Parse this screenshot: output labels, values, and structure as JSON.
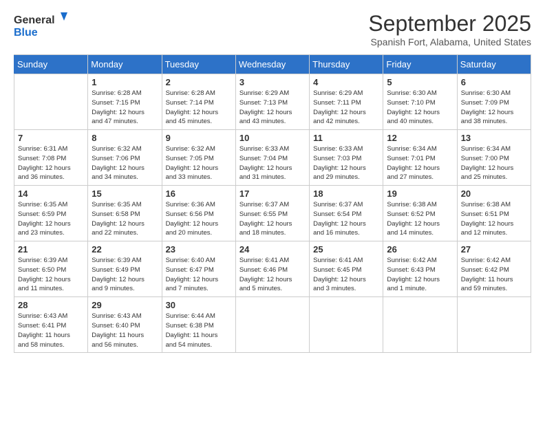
{
  "header": {
    "logo_line1": "General",
    "logo_line2": "Blue",
    "month": "September 2025",
    "location": "Spanish Fort, Alabama, United States"
  },
  "days_of_week": [
    "Sunday",
    "Monday",
    "Tuesday",
    "Wednesday",
    "Thursday",
    "Friday",
    "Saturday"
  ],
  "weeks": [
    [
      {
        "day": "",
        "info": ""
      },
      {
        "day": "1",
        "info": "Sunrise: 6:28 AM\nSunset: 7:15 PM\nDaylight: 12 hours\nand 47 minutes."
      },
      {
        "day": "2",
        "info": "Sunrise: 6:28 AM\nSunset: 7:14 PM\nDaylight: 12 hours\nand 45 minutes."
      },
      {
        "day": "3",
        "info": "Sunrise: 6:29 AM\nSunset: 7:13 PM\nDaylight: 12 hours\nand 43 minutes."
      },
      {
        "day": "4",
        "info": "Sunrise: 6:29 AM\nSunset: 7:11 PM\nDaylight: 12 hours\nand 42 minutes."
      },
      {
        "day": "5",
        "info": "Sunrise: 6:30 AM\nSunset: 7:10 PM\nDaylight: 12 hours\nand 40 minutes."
      },
      {
        "day": "6",
        "info": "Sunrise: 6:30 AM\nSunset: 7:09 PM\nDaylight: 12 hours\nand 38 minutes."
      }
    ],
    [
      {
        "day": "7",
        "info": "Sunrise: 6:31 AM\nSunset: 7:08 PM\nDaylight: 12 hours\nand 36 minutes."
      },
      {
        "day": "8",
        "info": "Sunrise: 6:32 AM\nSunset: 7:06 PM\nDaylight: 12 hours\nand 34 minutes."
      },
      {
        "day": "9",
        "info": "Sunrise: 6:32 AM\nSunset: 7:05 PM\nDaylight: 12 hours\nand 33 minutes."
      },
      {
        "day": "10",
        "info": "Sunrise: 6:33 AM\nSunset: 7:04 PM\nDaylight: 12 hours\nand 31 minutes."
      },
      {
        "day": "11",
        "info": "Sunrise: 6:33 AM\nSunset: 7:03 PM\nDaylight: 12 hours\nand 29 minutes."
      },
      {
        "day": "12",
        "info": "Sunrise: 6:34 AM\nSunset: 7:01 PM\nDaylight: 12 hours\nand 27 minutes."
      },
      {
        "day": "13",
        "info": "Sunrise: 6:34 AM\nSunset: 7:00 PM\nDaylight: 12 hours\nand 25 minutes."
      }
    ],
    [
      {
        "day": "14",
        "info": "Sunrise: 6:35 AM\nSunset: 6:59 PM\nDaylight: 12 hours\nand 23 minutes."
      },
      {
        "day": "15",
        "info": "Sunrise: 6:35 AM\nSunset: 6:58 PM\nDaylight: 12 hours\nand 22 minutes."
      },
      {
        "day": "16",
        "info": "Sunrise: 6:36 AM\nSunset: 6:56 PM\nDaylight: 12 hours\nand 20 minutes."
      },
      {
        "day": "17",
        "info": "Sunrise: 6:37 AM\nSunset: 6:55 PM\nDaylight: 12 hours\nand 18 minutes."
      },
      {
        "day": "18",
        "info": "Sunrise: 6:37 AM\nSunset: 6:54 PM\nDaylight: 12 hours\nand 16 minutes."
      },
      {
        "day": "19",
        "info": "Sunrise: 6:38 AM\nSunset: 6:52 PM\nDaylight: 12 hours\nand 14 minutes."
      },
      {
        "day": "20",
        "info": "Sunrise: 6:38 AM\nSunset: 6:51 PM\nDaylight: 12 hours\nand 12 minutes."
      }
    ],
    [
      {
        "day": "21",
        "info": "Sunrise: 6:39 AM\nSunset: 6:50 PM\nDaylight: 12 hours\nand 11 minutes."
      },
      {
        "day": "22",
        "info": "Sunrise: 6:39 AM\nSunset: 6:49 PM\nDaylight: 12 hours\nand 9 minutes."
      },
      {
        "day": "23",
        "info": "Sunrise: 6:40 AM\nSunset: 6:47 PM\nDaylight: 12 hours\nand 7 minutes."
      },
      {
        "day": "24",
        "info": "Sunrise: 6:41 AM\nSunset: 6:46 PM\nDaylight: 12 hours\nand 5 minutes."
      },
      {
        "day": "25",
        "info": "Sunrise: 6:41 AM\nSunset: 6:45 PM\nDaylight: 12 hours\nand 3 minutes."
      },
      {
        "day": "26",
        "info": "Sunrise: 6:42 AM\nSunset: 6:43 PM\nDaylight: 12 hours\nand 1 minute."
      },
      {
        "day": "27",
        "info": "Sunrise: 6:42 AM\nSunset: 6:42 PM\nDaylight: 11 hours\nand 59 minutes."
      }
    ],
    [
      {
        "day": "28",
        "info": "Sunrise: 6:43 AM\nSunset: 6:41 PM\nDaylight: 11 hours\nand 58 minutes."
      },
      {
        "day": "29",
        "info": "Sunrise: 6:43 AM\nSunset: 6:40 PM\nDaylight: 11 hours\nand 56 minutes."
      },
      {
        "day": "30",
        "info": "Sunrise: 6:44 AM\nSunset: 6:38 PM\nDaylight: 11 hours\nand 54 minutes."
      },
      {
        "day": "",
        "info": ""
      },
      {
        "day": "",
        "info": ""
      },
      {
        "day": "",
        "info": ""
      },
      {
        "day": "",
        "info": ""
      }
    ]
  ]
}
